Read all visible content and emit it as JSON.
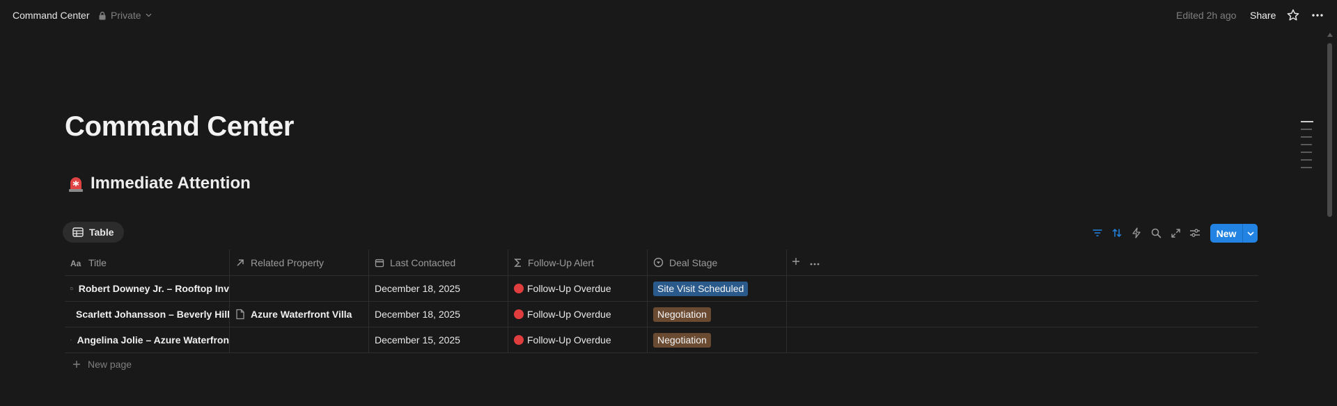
{
  "topbar": {
    "breadcrumb": "Command Center",
    "privacy": "Private",
    "edited": "Edited 2h ago",
    "share": "Share"
  },
  "page": {
    "title": "Command Center",
    "section_heading": "Immediate Attention",
    "section_icon": "siren-icon"
  },
  "view": {
    "tab_label": "Table",
    "new_label": "New"
  },
  "toolbar_icons": [
    "filter-icon",
    "sort-icon",
    "automation-icon",
    "search-icon",
    "expand-icon",
    "settings-icon"
  ],
  "table": {
    "columns": [
      {
        "label": "Title",
        "icon": "text-type-icon"
      },
      {
        "label": "Related Property",
        "icon": "arrow-up-right-icon"
      },
      {
        "label": "Last Contacted",
        "icon": "calendar-icon"
      },
      {
        "label": "Follow-Up Alert",
        "icon": "sigma-icon"
      },
      {
        "label": "Deal Stage",
        "icon": "status-icon"
      }
    ],
    "rows": [
      {
        "title": "Robert Downey Jr. – Rooftop Inv",
        "related": "",
        "last_contacted": "December 18, 2025",
        "alert": "Follow-Up Overdue",
        "stage": "Site Visit Scheduled",
        "stage_color": "#2a5a8c"
      },
      {
        "title": "Scarlett Johansson – Beverly Hill",
        "related": "Azure Waterfront Villa",
        "last_contacted": "December 18, 2025",
        "alert": "Follow-Up Overdue",
        "stage": "Negotiation",
        "stage_color": "#6b4a32"
      },
      {
        "title": "Angelina Jolie – Azure Waterfron",
        "related": "",
        "last_contacted": "December 15, 2025",
        "alert": "Follow-Up Overdue",
        "stage": "Negotiation",
        "stage_color": "#6b4a32"
      }
    ],
    "new_page": "New page"
  },
  "colors": {
    "background": "#191919",
    "accent": "#2383e2",
    "alert": "#e03e3e"
  }
}
